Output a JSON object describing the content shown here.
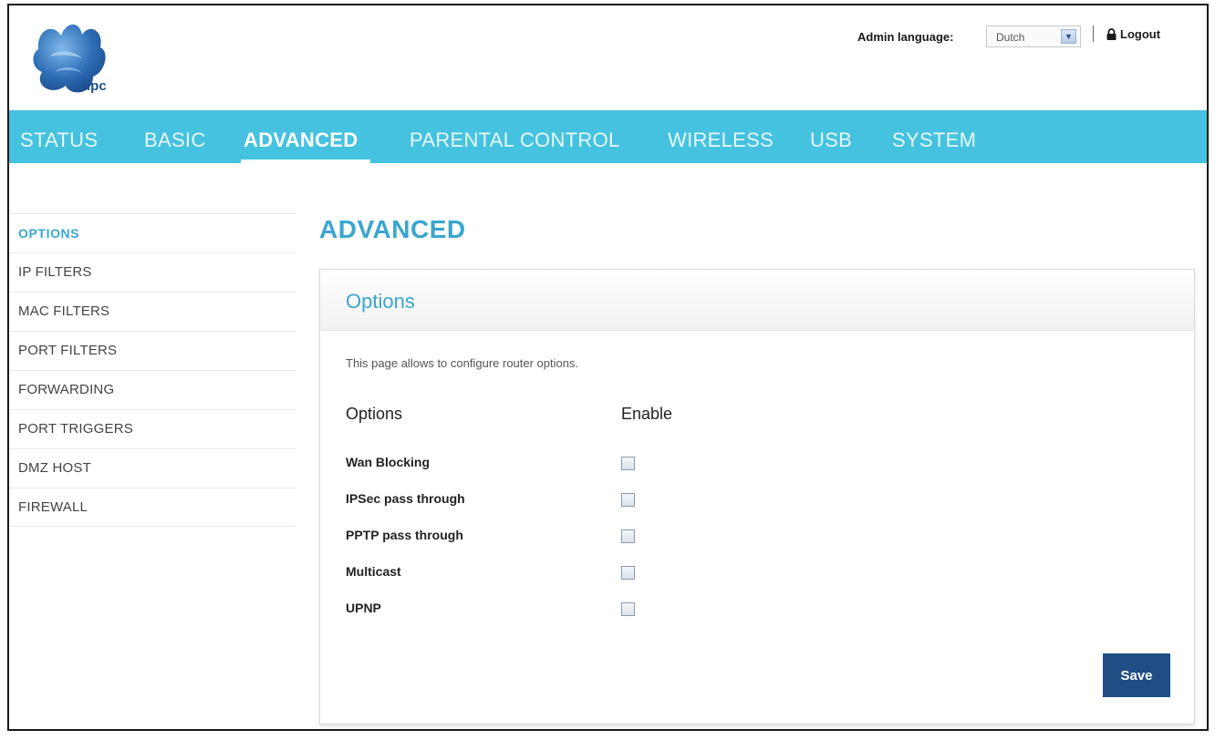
{
  "header": {
    "logo_text": "upc",
    "admin_language_label": "Admin language:",
    "language_value": "Dutch",
    "logout_label": "Logout"
  },
  "nav": {
    "items": [
      {
        "label": "STATUS",
        "active": false
      },
      {
        "label": "BASIC",
        "active": false
      },
      {
        "label": "ADVANCED",
        "active": true
      },
      {
        "label": "PARENTAL CONTROL",
        "active": false
      },
      {
        "label": "WIRELESS",
        "active": false
      },
      {
        "label": "USB",
        "active": false
      },
      {
        "label": "SYSTEM",
        "active": false
      }
    ]
  },
  "sidebar": {
    "items": [
      {
        "label": "OPTIONS",
        "active": true
      },
      {
        "label": "IP FILTERS",
        "active": false
      },
      {
        "label": "MAC FILTERS",
        "active": false
      },
      {
        "label": "PORT FILTERS",
        "active": false
      },
      {
        "label": "FORWARDING",
        "active": false
      },
      {
        "label": "PORT TRIGGERS",
        "active": false
      },
      {
        "label": "DMZ HOST",
        "active": false
      },
      {
        "label": "FIREWALL",
        "active": false
      }
    ]
  },
  "main": {
    "page_title": "ADVANCED",
    "panel_title": "Options",
    "description": "This page allows to configure router options.",
    "col_options": "Options",
    "col_enable": "Enable",
    "options": [
      {
        "label": "Wan Blocking",
        "enabled": false
      },
      {
        "label": "IPSec pass through",
        "enabled": false
      },
      {
        "label": "PPTP pass through",
        "enabled": false
      },
      {
        "label": "Multicast",
        "enabled": false
      },
      {
        "label": "UPNP",
        "enabled": false
      }
    ],
    "save_label": "Save"
  },
  "colors": {
    "nav_bg": "#45c2e0",
    "accent": "#3aa6cf",
    "button": "#1f4e84"
  }
}
